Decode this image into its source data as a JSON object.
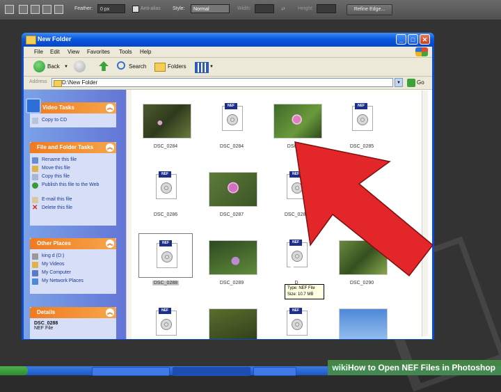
{
  "photoshop": {
    "feather_label": "Feather:",
    "feather_value": "0 px",
    "antialias_label": "Anti-alias",
    "style_label": "Style:",
    "style_value": "Normal",
    "width_label": "Width:",
    "height_label": "Height:",
    "refine_edge_label": "Refine Edge..."
  },
  "window": {
    "title": "New Folder",
    "menu": [
      "File",
      "Edit",
      "View",
      "Favorites",
      "Tools",
      "Help"
    ],
    "toolbar": {
      "back": "Back",
      "search": "Search",
      "folders": "Folders"
    },
    "address_label": "Address",
    "address_value": "D:\\New Folder",
    "go_label": "Go"
  },
  "taskpane": {
    "video_tasks": {
      "title": "Video Tasks",
      "items": [
        "Copy to CD"
      ]
    },
    "file_folder_tasks": {
      "title": "File and Folder Tasks",
      "items": [
        "Rename this file",
        "Move this file",
        "Copy this file",
        "Publish this file to the Web",
        "E-mail this file",
        "Delete this file"
      ]
    },
    "other_places": {
      "title": "Other Places",
      "items": [
        "king d (D:)",
        "My Videos",
        "My Computer",
        "My Network Places"
      ]
    },
    "details": {
      "title": "Details",
      "name": "DSC_0288",
      "type": "NEF File"
    }
  },
  "files": [
    {
      "name": "DSC_0284",
      "kind": "photo",
      "style": "p1"
    },
    {
      "name": "DSC_0284",
      "kind": "nef"
    },
    {
      "name": "DSC_02",
      "kind": "photo",
      "style": "p2"
    },
    {
      "name": "DSC_0285",
      "kind": "nef"
    },
    {
      "name": "DSC_0286",
      "kind": "nef"
    },
    {
      "name": "DSC_0287",
      "kind": "photo",
      "style": "p4"
    },
    {
      "name": "DSC_0287",
      "kind": "nef"
    },
    {
      "name": "",
      "kind": "none"
    },
    {
      "name": "DSC_0288",
      "kind": "nef",
      "selected": true
    },
    {
      "name": "DSC_0289",
      "kind": "photo",
      "style": "p3"
    },
    {
      "name": "D",
      "kind": "nef"
    },
    {
      "name": "DSC_0290",
      "kind": "photo",
      "style": "p5"
    },
    {
      "name": "",
      "kind": "nef"
    },
    {
      "name": "",
      "kind": "photo",
      "style": "p6"
    },
    {
      "name": "",
      "kind": "nef"
    },
    {
      "name": "",
      "kind": "photo",
      "style": "p7"
    }
  ],
  "tooltip": {
    "line1": "Type: NEF File",
    "line2": "Size: 10.7 MB"
  },
  "nef_badge": "NEF",
  "footer": {
    "brand": "wiki",
    "caption": "How to Open NEF Files in Photoshop"
  },
  "colors": {
    "arrow": "#e3262a",
    "panel_header": "#f07a1f",
    "xp_blue": "#0a4bd1"
  }
}
